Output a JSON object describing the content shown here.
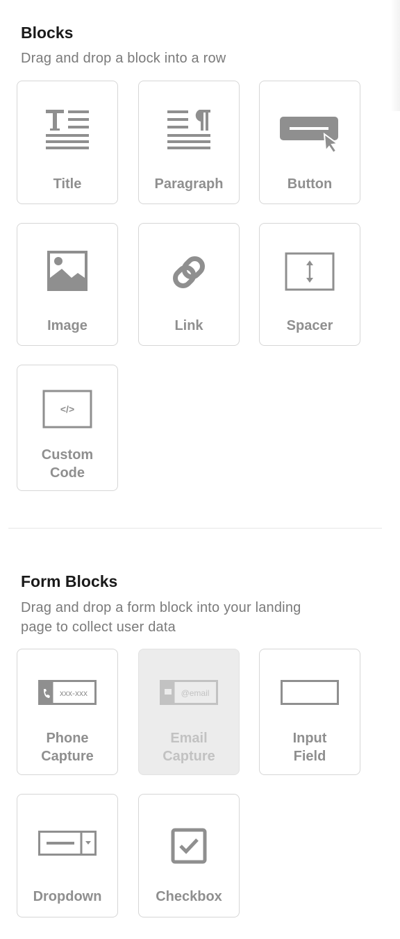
{
  "blocks_section": {
    "title": "Blocks",
    "subtitle": "Drag and drop a block into a row",
    "items": [
      {
        "label": "Title",
        "icon": "title-icon"
      },
      {
        "label": "Paragraph",
        "icon": "paragraph-icon"
      },
      {
        "label": "Button",
        "icon": "button-icon"
      },
      {
        "label": "Image",
        "icon": "image-icon"
      },
      {
        "label": "Link",
        "icon": "link-icon"
      },
      {
        "label": "Spacer",
        "icon": "spacer-icon"
      },
      {
        "label_line1": "Custom",
        "label_line2": "Code",
        "icon": "code-icon"
      }
    ]
  },
  "form_section": {
    "title": "Form Blocks",
    "subtitle_line1": "Drag and drop a form block into your landing",
    "subtitle_line2": "page to collect user data",
    "items": [
      {
        "label_line1": "Phone",
        "label_line2": "Capture",
        "icon": "phone-capture-icon",
        "icon_text": "xxx-xxx"
      },
      {
        "label_line1": "Email",
        "label_line2": "Capture",
        "icon": "email-capture-icon",
        "icon_text": "@email",
        "disabled": true
      },
      {
        "label_line1": "Input",
        "label_line2": "Field",
        "icon": "input-field-icon"
      },
      {
        "label": "Dropdown",
        "icon": "dropdown-icon"
      },
      {
        "label": "Checkbox",
        "icon": "checkbox-icon"
      }
    ]
  },
  "colors": {
    "icon_gray": "#8f8f8f",
    "label_gray": "#8f8f8f",
    "disabled_bg": "#ececec",
    "border": "#d6d6d6"
  }
}
